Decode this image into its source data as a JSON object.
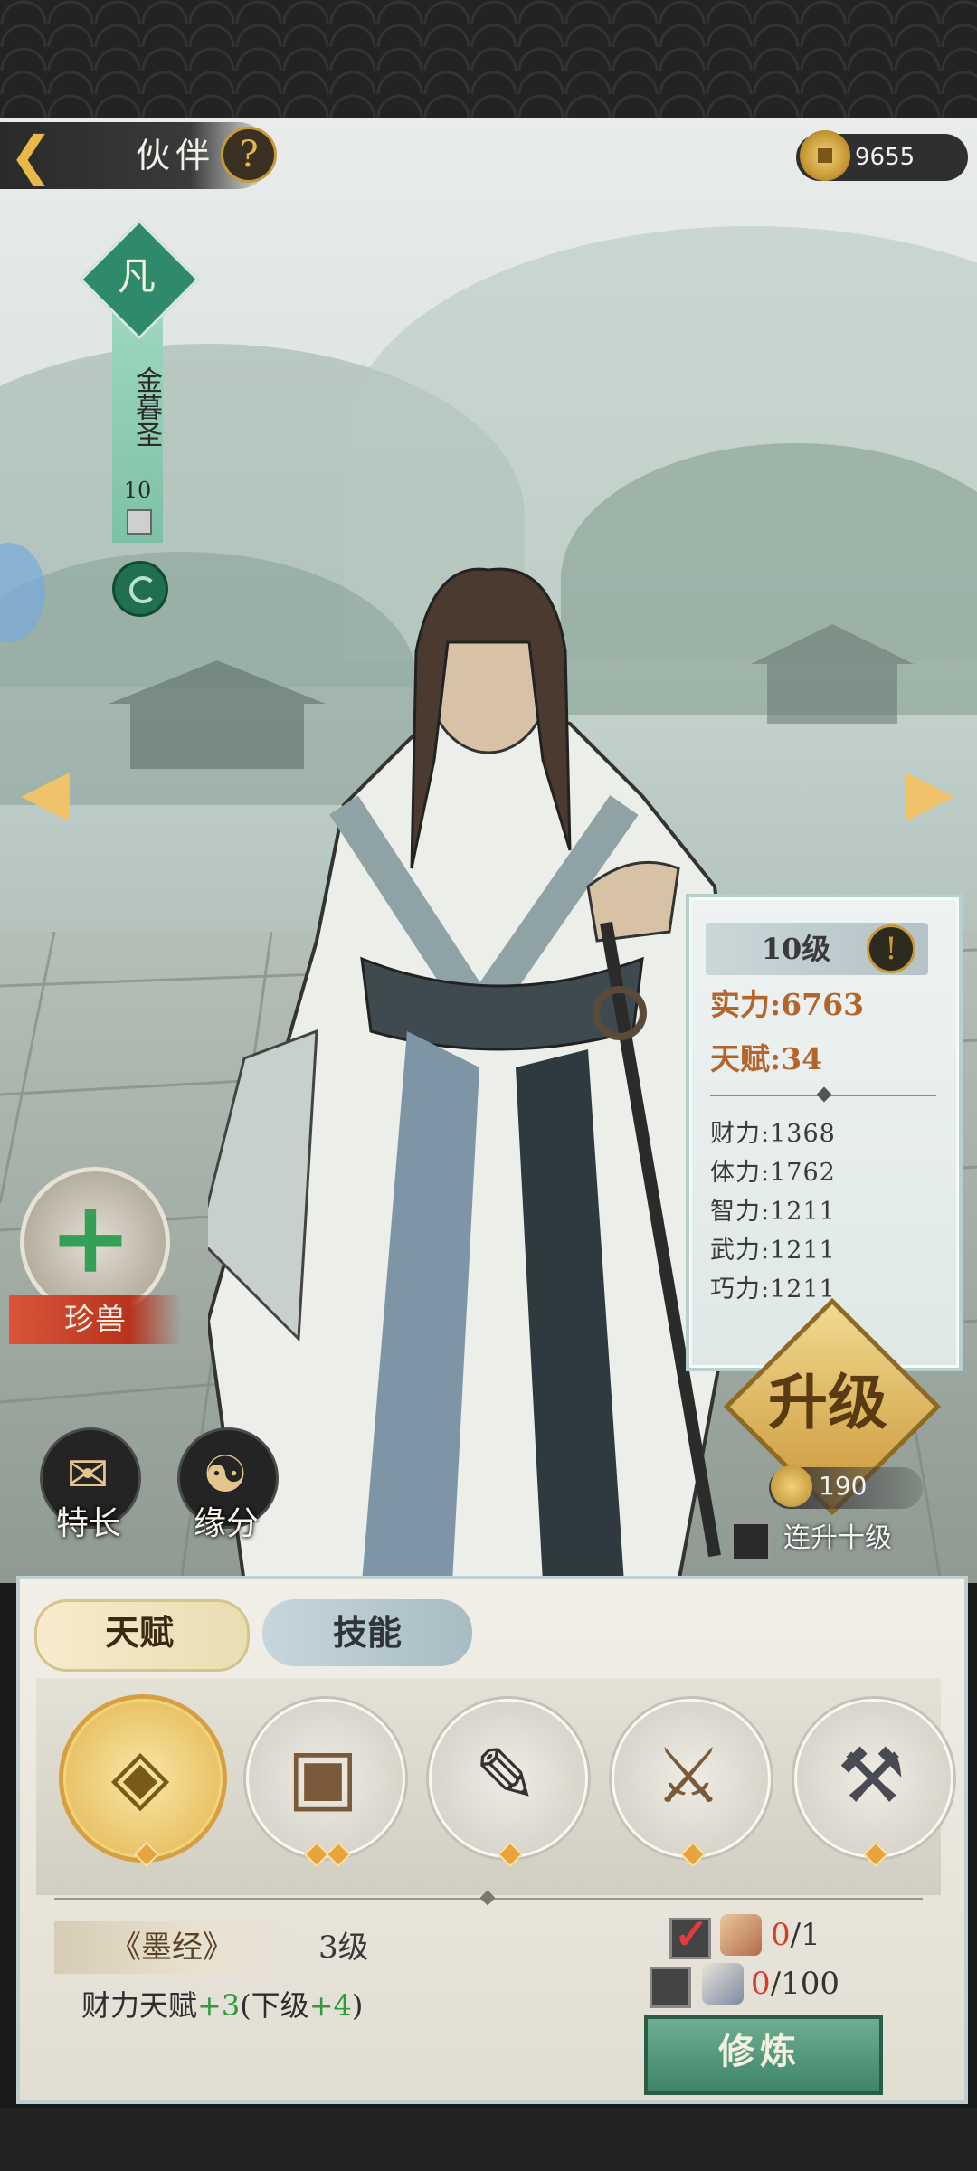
{
  "header": {
    "title": "伙伴",
    "help": "?",
    "coins": "9655"
  },
  "character": {
    "rank": "凡",
    "name": "金暮圣",
    "level": "10"
  },
  "stats": {
    "level_label": "10级",
    "info": "!",
    "strength": "实力:6763",
    "talent": "天赋:34",
    "attrs": [
      "财力:1368",
      "体力:1762",
      "智力:1211",
      "武力:1211",
      "巧力:1211"
    ]
  },
  "upgrade": {
    "label": "升级",
    "cost": "190",
    "auto10_label": "连升十级"
  },
  "pet": {
    "label": "珍兽",
    "plus": "+"
  },
  "features": {
    "specialty": "特长",
    "fate": "缘分"
  },
  "tabs": {
    "talent": "天赋",
    "skill": "技能"
  },
  "talent_slots": [
    {
      "icon": "coin-icon",
      "glyph": "◈",
      "stars": 1
    },
    {
      "icon": "lock-icon",
      "glyph": "▣",
      "stars": 2
    },
    {
      "icon": "scroll-brush-icon",
      "glyph": "✎",
      "stars": 1
    },
    {
      "icon": "sword-icon",
      "glyph": "⚔",
      "stars": 1
    },
    {
      "icon": "anvil-icon",
      "glyph": "⚒",
      "stars": 1
    }
  ],
  "talent_detail": {
    "scroll_name": "《墨经》",
    "scroll_level": "3级",
    "effect_prefix": "财力天赋",
    "effect_bonus": "+3",
    "effect_next_open": "(下级",
    "effect_next_bonus": "+4",
    "effect_next_close": ")"
  },
  "requirements": [
    {
      "checked": true,
      "have": "0",
      "need": "/1"
    },
    {
      "checked": false,
      "have": "0",
      "need": "/100"
    }
  ],
  "train": {
    "label": "修炼"
  },
  "colors": {
    "accent_gold": "#e2b552",
    "jade": "#2e8a6a",
    "plus_green": "#2d9a3c",
    "warn_red": "#d43c2a"
  }
}
